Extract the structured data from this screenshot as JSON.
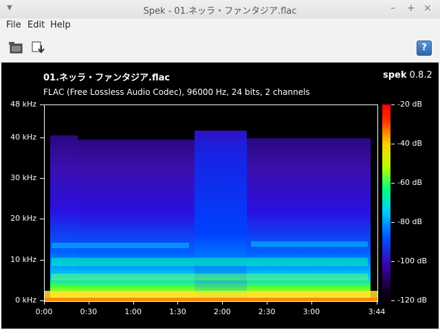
{
  "window": {
    "title": "Spek - 01.ネッラ・ファンタジア.flac",
    "minimize": "–",
    "maximize": "+",
    "close": "×"
  },
  "menu": [
    "File",
    "Edit",
    "Help"
  ],
  "toolbar": {
    "help": "?"
  },
  "viewer": {
    "file_title": "01.ネッラ・ファンタジア.flac",
    "file_info": "FLAC (Free Lossless Audio Codec), 96000 Hz, 24 bits, 2 channels",
    "app_name": "spek",
    "app_version": "0.8.2",
    "freq_ticks": [
      "48 kHz",
      "40 kHz",
      "30 kHz",
      "20 kHz",
      "10 kHz",
      "0 kHz"
    ],
    "freq_values": [
      48,
      40,
      30,
      20,
      10,
      0
    ],
    "time_ticks": [
      "0:00",
      "0:30",
      "1:00",
      "1:30",
      "2:00",
      "2:30",
      "3:00",
      "3:44"
    ],
    "time_seconds": [
      0,
      30,
      60,
      90,
      120,
      150,
      180,
      224
    ],
    "db_ticks": [
      "-20 dB",
      "-40 dB",
      "-60 dB",
      "-80 dB",
      "-100 dB",
      "-120 dB"
    ],
    "db_values": [
      -20,
      -40,
      -60,
      -80,
      -100,
      -120
    ]
  }
}
